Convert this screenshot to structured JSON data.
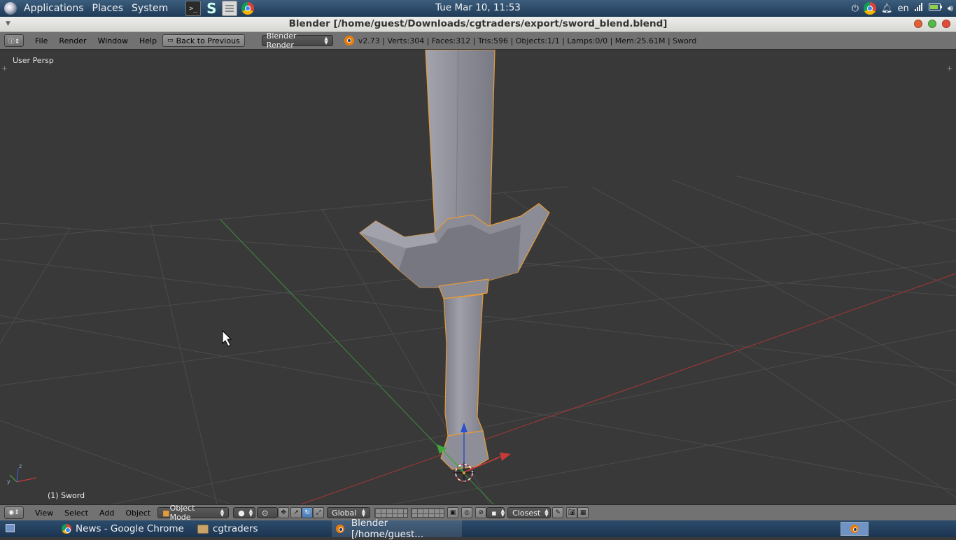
{
  "top_panel": {
    "menus": [
      "Applications",
      "Places",
      "System"
    ],
    "launchers": [
      "terminal-icon",
      "s-app-icon",
      "file-manager-icon",
      "chrome-icon"
    ],
    "clock": "Tue Mar 10, 11:53",
    "keyboard_layout": "en",
    "tray_icons": [
      "power-icon",
      "chrome-icon",
      "notification-bell-icon",
      "signal-icon",
      "battery-icon",
      "volume-icon"
    ]
  },
  "window": {
    "title": "Blender [/home/guest/Downloads/cgtraders/export/sword_blend.blend]",
    "button_colors": {
      "close": "#e0603a",
      "minimize": "#e8b33a",
      "maximize": "#56b84a"
    }
  },
  "info_header": {
    "menus": [
      "File",
      "Render",
      "Window",
      "Help"
    ],
    "back_button": "Back to Previous",
    "render_engine": "Blender Render",
    "stats": "v2.73 | Verts:304 | Faces:312 | Tris:596 | Objects:1/1 | Lamps:0/0 | Mem:25.61M | Sword"
  },
  "viewport": {
    "view_label": "User Persp",
    "object_label": "(1) Sword",
    "colors": {
      "background": "#393939",
      "grid": "#4a4a4a",
      "x_axis": "#b33a3a",
      "y_axis": "#3e9a3e",
      "mesh": "#8e8e98",
      "selection_outline": "#e49b3a",
      "z_arrow": "#2a4fd0"
    }
  },
  "view3d_header": {
    "menus": [
      "View",
      "Select",
      "Add",
      "Object"
    ],
    "mode": "Object Mode",
    "transform_orientation": "Global",
    "snap_target": "Closest"
  },
  "taskbar": {
    "tasks": [
      {
        "label": "News - Google Chrome",
        "icon": "chrome-icon"
      },
      {
        "label": "cgtraders",
        "icon": "folder-icon"
      },
      {
        "label": "Blender [/home/guest...",
        "icon": "blender-icon"
      }
    ]
  }
}
